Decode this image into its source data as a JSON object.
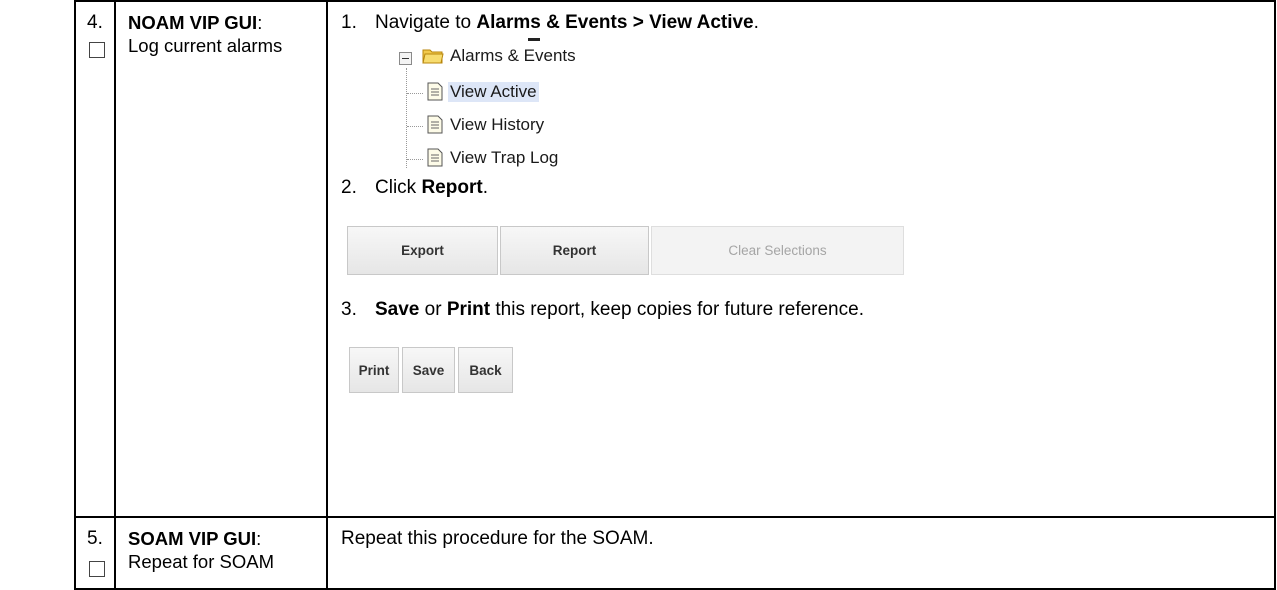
{
  "rows": [
    {
      "step": "4.",
      "title_bold": "NOAM VIP GUI",
      "title_colon": ":",
      "title_rest": "Log current alarms",
      "instructions": {
        "i1": {
          "num": "1.",
          "pre": "Navigate to ",
          "bold": "Alarms & Events > View Active",
          "post": "."
        },
        "i2": {
          "num": "2.",
          "pre": "Click ",
          "bold": "Report",
          "post": "."
        },
        "i3": {
          "num": "3.",
          "bold1": "Save",
          "mid": " or ",
          "bold2": "Print",
          "post": " this report, keep copies for future reference."
        }
      },
      "tree": {
        "folder_label": "Alarms & Events",
        "items": [
          "View Active",
          "View History",
          "View Trap Log"
        ]
      },
      "buttons_1": [
        "Export",
        "Report",
        "Clear Selections"
      ],
      "buttons_2": [
        "Print",
        "Save",
        "Back"
      ]
    },
    {
      "step": "5.",
      "title_bold": "SOAM VIP GUI",
      "title_colon": ":",
      "title_rest": "Repeat for SOAM",
      "body": "Repeat this procedure for the SOAM."
    }
  ],
  "colors": {
    "selected_bg": "#dde6f7",
    "folder": "#e8b533"
  }
}
